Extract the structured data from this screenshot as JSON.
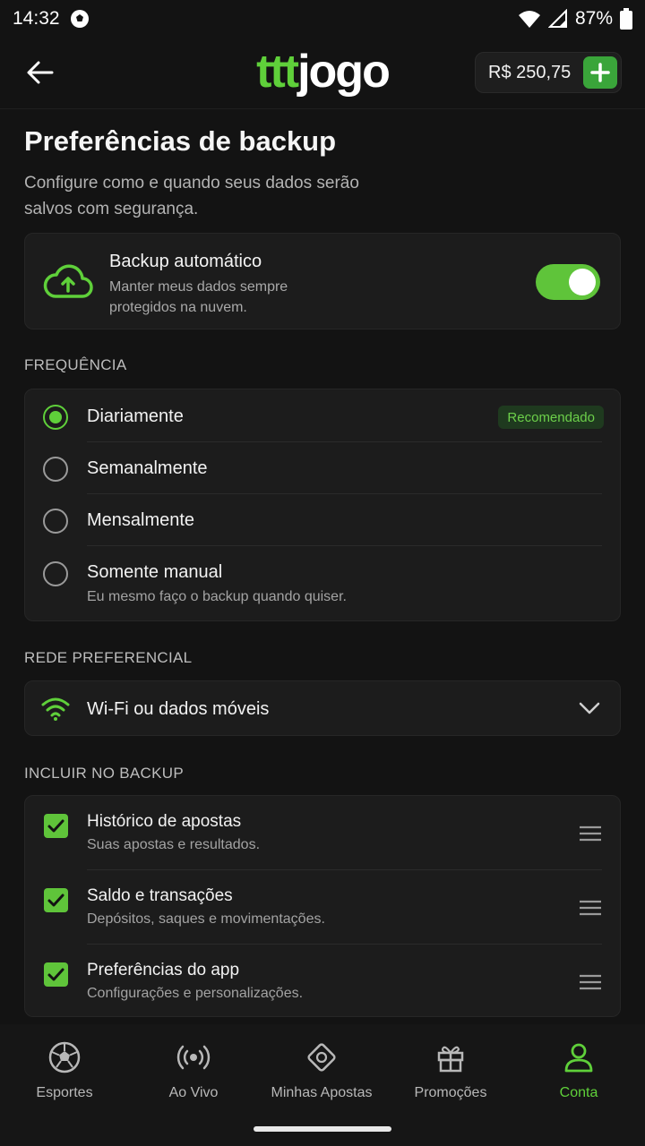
{
  "statusbar": {
    "time": "14:32",
    "battery": "87%"
  },
  "header": {
    "logo_part1": "ttt",
    "logo_part2": "jogo",
    "balance": "R$ 250,75"
  },
  "page": {
    "title": "Preferências de backup",
    "subtitle": "Configure como e quando seus dados serão salvos com segurança."
  },
  "auto_backup": {
    "title": "Backup automático",
    "description": "Manter meus dados sempre protegidos na nuvem.",
    "enabled": true
  },
  "frequency": {
    "label": "FREQUÊNCIA",
    "badge": "Recomendado",
    "options": [
      {
        "label": "Diariamente",
        "selected": true
      },
      {
        "label": "Semanalmente",
        "selected": false
      },
      {
        "label": "Mensalmente",
        "selected": false
      },
      {
        "label": "Somente manual",
        "sub": "Eu mesmo faço o backup quando quiser.",
        "selected": false
      }
    ]
  },
  "network": {
    "label": "REDE PREFERENCIAL",
    "value": "Wi-Fi ou dados móveis"
  },
  "include": {
    "label": "INCLUIR NO BACKUP",
    "items": [
      {
        "label": "Histórico de apostas",
        "sub": "Suas apostas e resultados.",
        "checked": true
      },
      {
        "label": "Saldo e transações",
        "sub": "Depósitos, saques e movimentações.",
        "checked": true
      },
      {
        "label": "Preferências do app",
        "sub": "Configurações e personalizações.",
        "checked": true
      }
    ]
  },
  "nav": {
    "items": [
      {
        "label": "Esportes",
        "icon": "soccer-ball-icon"
      },
      {
        "label": "Ao Vivo",
        "icon": "live-broadcast-icon"
      },
      {
        "label": "Minhas Apostas",
        "icon": "ticket-icon"
      },
      {
        "label": "Promoções",
        "icon": "gift-icon"
      },
      {
        "label": "Conta",
        "icon": "user-icon",
        "active": true
      }
    ]
  },
  "colors": {
    "accent": "#5fd03a",
    "background": "#131313",
    "card": "#1c1c1c"
  }
}
